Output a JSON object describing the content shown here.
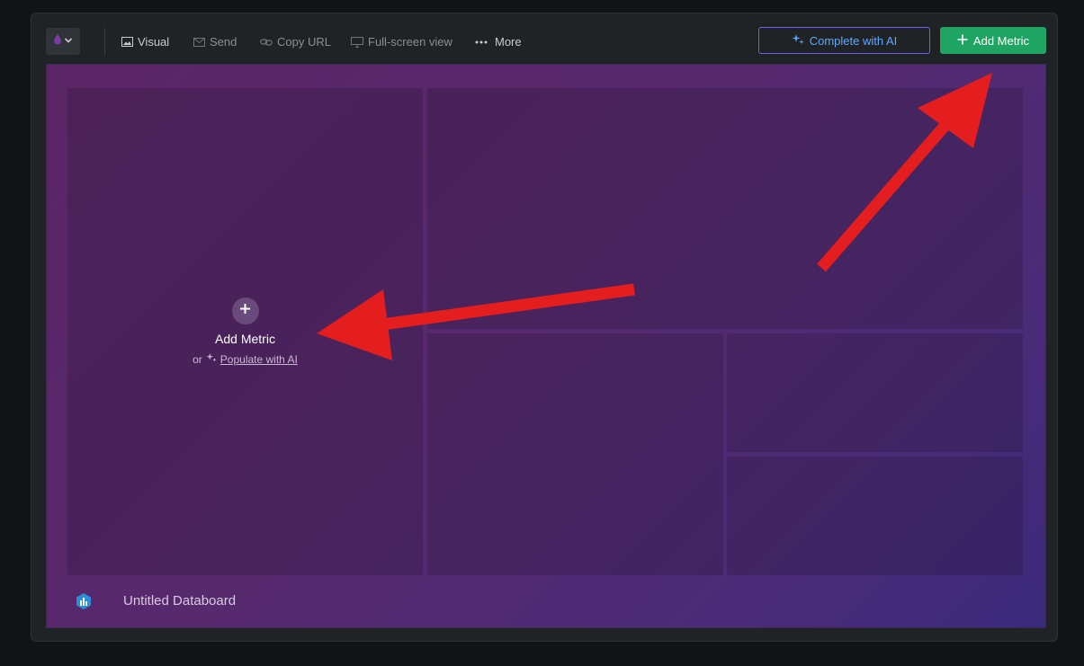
{
  "toolbar": {
    "visual_label": "Visual",
    "send_label": "Send",
    "copy_url_label": "Copy URL",
    "fullscreen_label": "Full-screen view",
    "more_label": "More",
    "complete_ai_label": "Complete with AI",
    "add_metric_label": "Add Metric"
  },
  "board": {
    "slot_add_label": "Add Metric",
    "or_label": "or",
    "populate_label": "Populate with AI",
    "title": "Untitled Databoard"
  },
  "colors": {
    "accent_green": "#1fa463",
    "ai_border": "#7a5cf0",
    "ai_text": "#5fa8ff",
    "annotation_arrow": "#e41e1e",
    "board_purple": "#57296d"
  },
  "icons": {
    "theme": "droplet-icon",
    "visual": "image-icon",
    "send": "envelope-icon",
    "copy_url": "link-icon",
    "fullscreen": "monitor-icon",
    "more": "ellipsis-icon",
    "ai": "sparkles-icon",
    "add": "plus-icon",
    "logo": "databox-logo-icon"
  }
}
